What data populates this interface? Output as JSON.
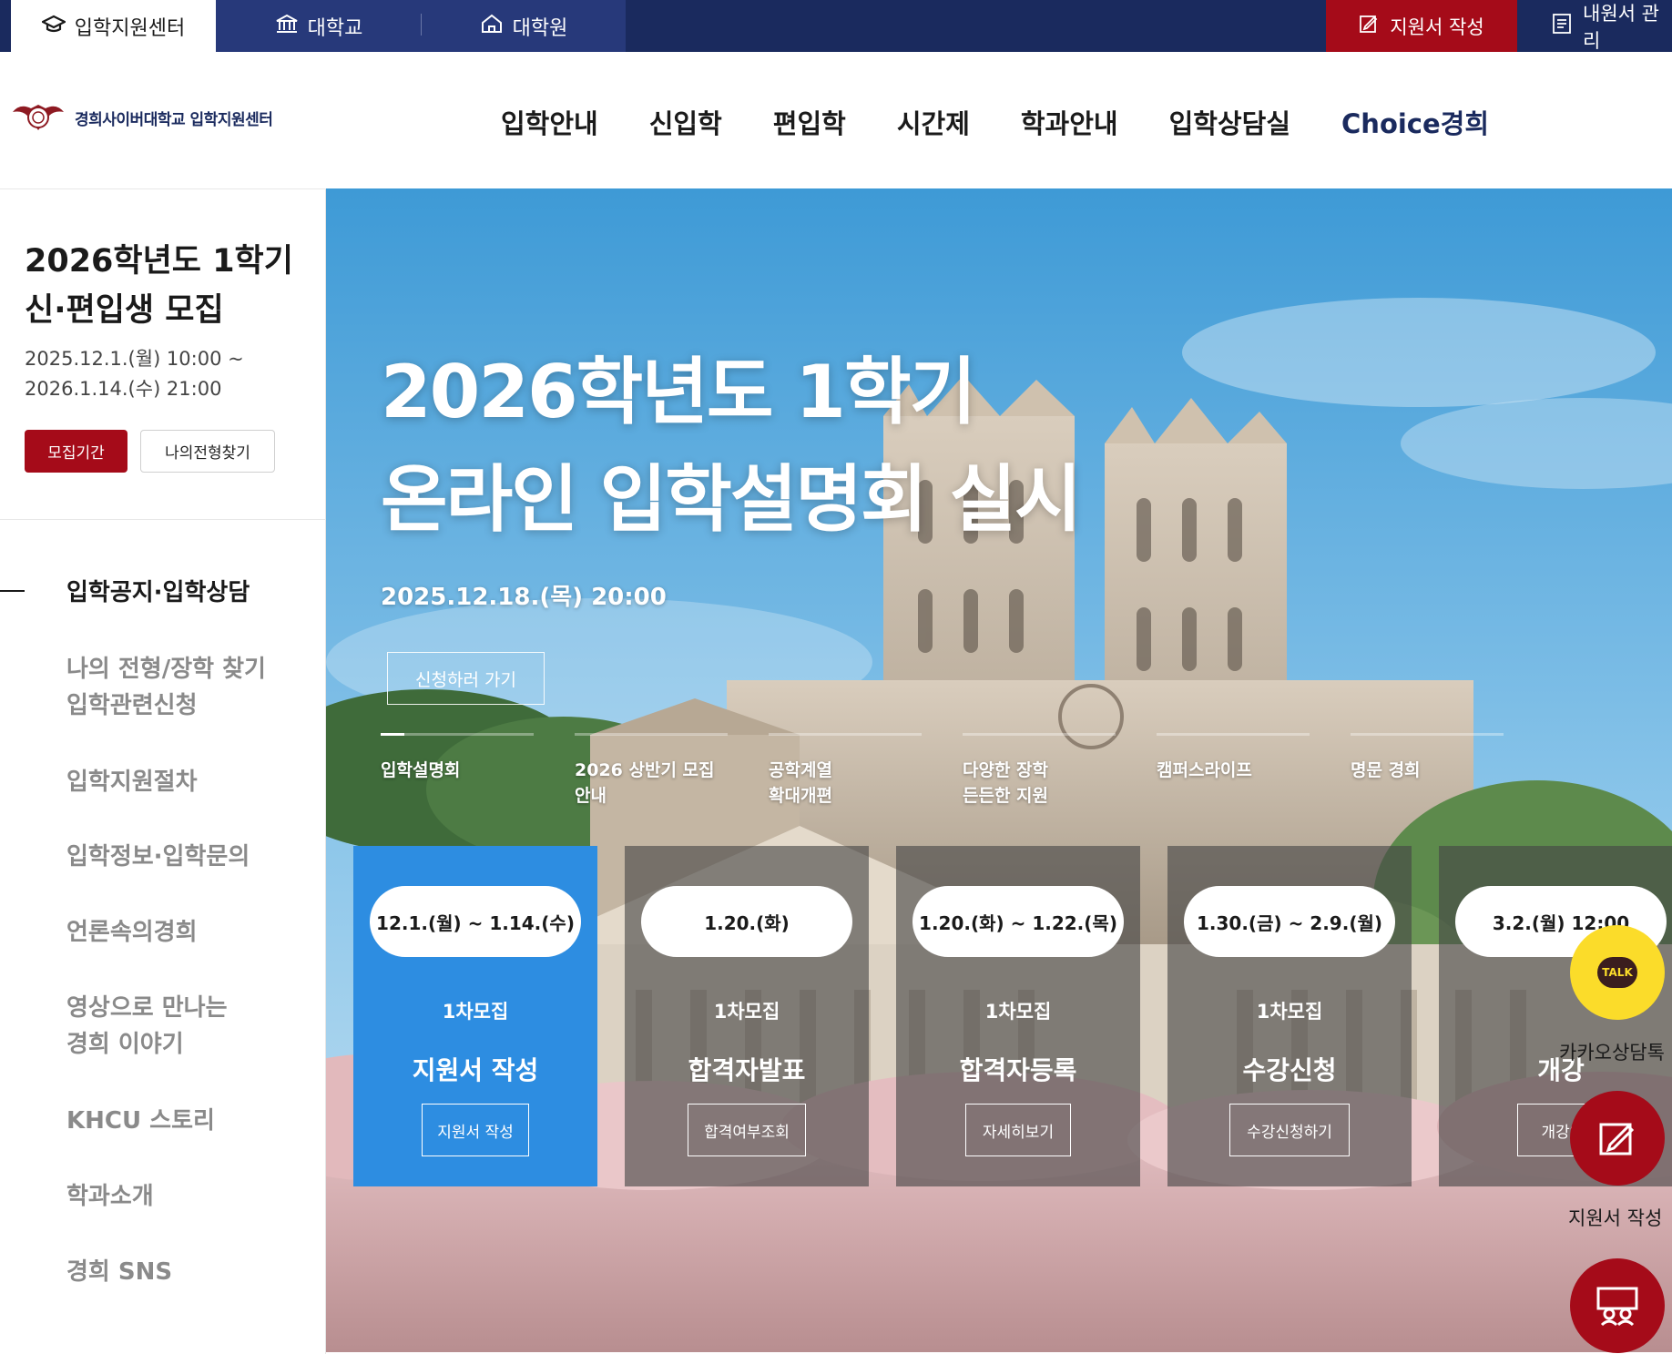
{
  "utility": {
    "center_label": "입학지원센터",
    "university_label": "대학교",
    "graduate_label": "대학원",
    "apply_label": "지원서 작성",
    "manage_label": "내원서 관리"
  },
  "header": {
    "logo_text": "경희사이버대학교 입학지원센터",
    "nav": [
      "입학안내",
      "신입학",
      "편입학",
      "시간제",
      "학과안내",
      "입학상담실",
      "Choice경희"
    ]
  },
  "sidebar": {
    "title_line1": "2026학년도 1학기",
    "title_line2": "신·편입생 모집",
    "date_line1": "2025.12.1.(월) 10:00 ~",
    "date_line2": "2026.1.14.(수) 21:00",
    "period_button": "모집기간",
    "find_button": "나의전형찾기",
    "menu": [
      {
        "line1": "입학공지·입학상담",
        "line2": ""
      },
      {
        "line1": "나의 전형/장학 찾기",
        "line2": "입학관련신청"
      },
      {
        "line1": "입학지원절차",
        "line2": ""
      },
      {
        "line1": "입학정보·입학문의",
        "line2": ""
      },
      {
        "line1": "언론속의경희",
        "line2": ""
      },
      {
        "line1": "영상으로 만나는",
        "line2": "경희 이야기"
      },
      {
        "line1": "KHCU 스토리",
        "line2": ""
      },
      {
        "line1": "학과소개",
        "line2": ""
      },
      {
        "line1": "경희 SNS",
        "line2": ""
      }
    ]
  },
  "hero": {
    "title_line1": "2026학년도 1학기",
    "title_line2": "온라인 입학설명회 실시",
    "date": "2025.12.18.(목) 20:00",
    "cta": "신청하러 가기",
    "tabs": [
      {
        "line1": "입학설명회",
        "line2": ""
      },
      {
        "line1": "2026 상반기 모집",
        "line2": "안내"
      },
      {
        "line1": "공학계열",
        "line2": "확대개편"
      },
      {
        "line1": "다양한 장학",
        "line2": "든든한 지원"
      },
      {
        "line1": "캠퍼스라이프",
        "line2": ""
      },
      {
        "line1": "명문 경희",
        "line2": ""
      }
    ]
  },
  "cards": [
    {
      "date": "12.1.(월) ~ 1.14.(수)",
      "round": "1차모집",
      "name": "지원서 작성",
      "button": "지원서 작성"
    },
    {
      "date": "1.20.(화)",
      "round": "1차모집",
      "name": "합격자발표",
      "button": "합격여부조회"
    },
    {
      "date": "1.20.(화) ~ 1.22.(목)",
      "round": "1차모집",
      "name": "합격자등록",
      "button": "자세히보기"
    },
    {
      "date": "1.30.(금) ~ 2.9.(월)",
      "round": "1차모집",
      "name": "수강신청",
      "button": "수강신청하기"
    },
    {
      "date": "3.2.(월) 12:00",
      "round": "",
      "name": "개강",
      "button": "개강안"
    }
  ],
  "floating": {
    "kakao_icon_text": "TALK",
    "kakao_label": "카카오상담톡",
    "apply_label": "지원서 작성"
  },
  "colors": {
    "navy": "#1a2a5e",
    "crimson": "#a50b19",
    "active_card": "#2d8de1",
    "kakao": "#fbdc2a"
  }
}
